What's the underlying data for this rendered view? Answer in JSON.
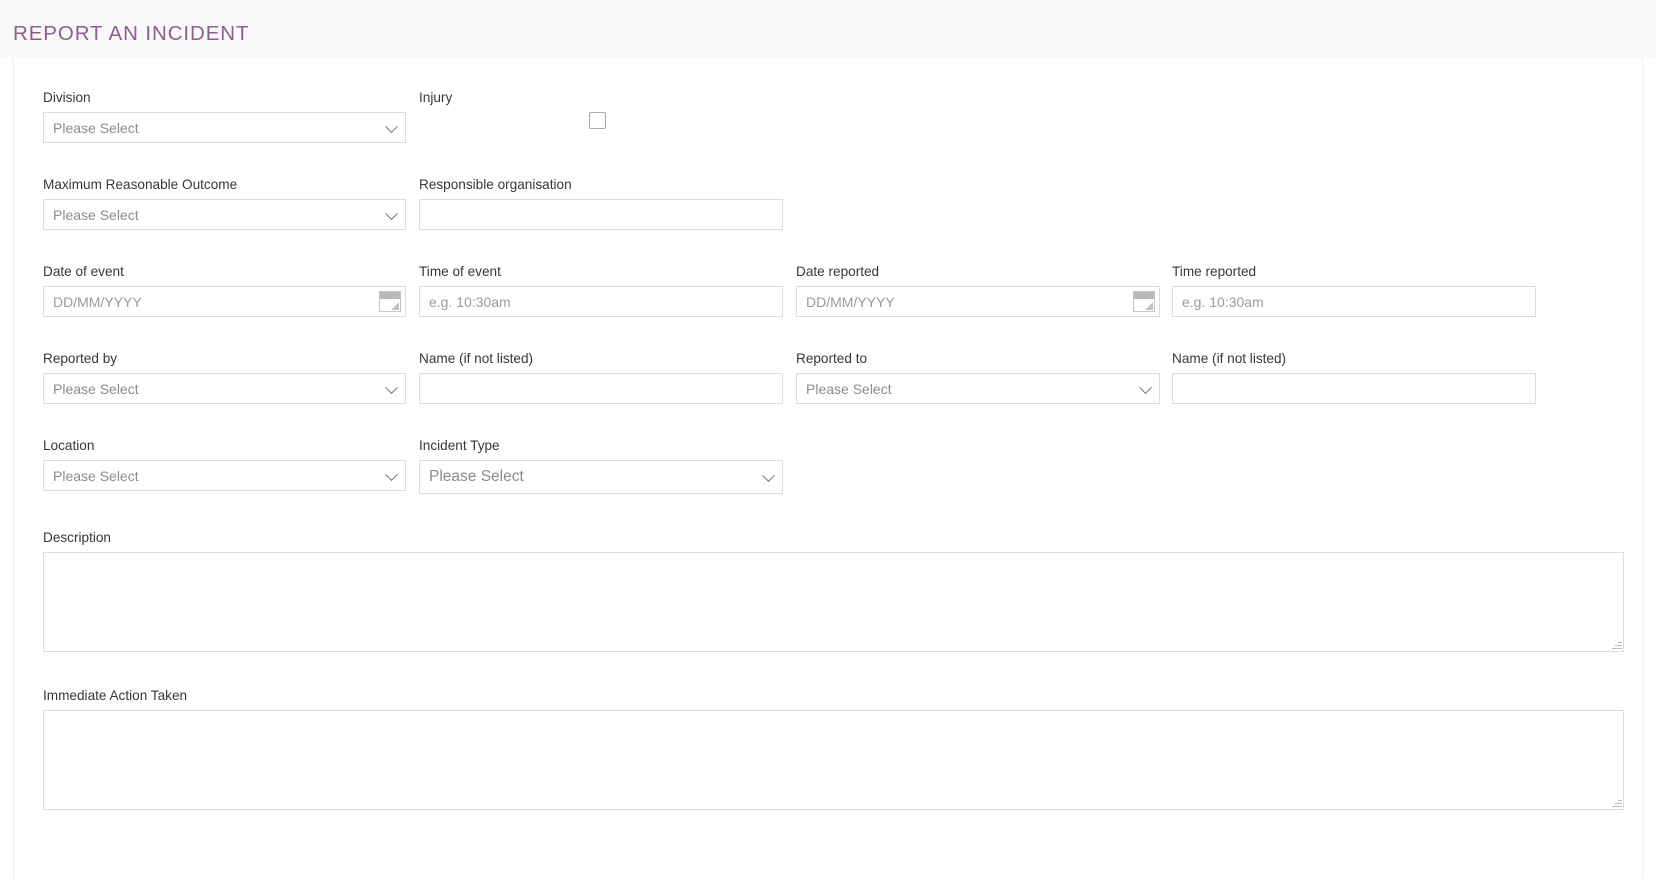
{
  "header": {
    "title": "REPORT AN INCIDENT",
    "title_color": "#8d5f8f",
    "band_color": "#f8f8f8"
  },
  "form": {
    "placeholder_select": "Please Select",
    "placeholder_date": "DD/MM/YYYY",
    "placeholder_time": "e.g. 10:30am",
    "fields": {
      "division": {
        "label": "Division",
        "value": "Please Select"
      },
      "injury": {
        "label": "Injury",
        "checked": false
      },
      "maximum_reasonable_outcome": {
        "label": "Maximum Reasonable Outcome",
        "value": "Please Select"
      },
      "responsible_organisation": {
        "label": "Responsible organisation",
        "value": "",
        "placeholder": ""
      },
      "date_of_event": {
        "label": "Date of event",
        "value": "",
        "placeholder": "DD/MM/YYYY"
      },
      "time_of_event": {
        "label": "Time of event",
        "value": "",
        "placeholder": "e.g. 10:30am"
      },
      "date_reported": {
        "label": "Date reported",
        "value": "",
        "placeholder": "DD/MM/YYYY"
      },
      "time_reported": {
        "label": "Time reported",
        "value": "",
        "placeholder": "e.g. 10:30am"
      },
      "reported_by": {
        "label": "Reported by",
        "value": "Please Select"
      },
      "reported_by_name": {
        "label": "Name (if not listed)",
        "value": "",
        "placeholder": ""
      },
      "reported_to": {
        "label": "Reported to",
        "value": "Please Select"
      },
      "reported_to_name": {
        "label": "Name (if not listed)",
        "value": "",
        "placeholder": ""
      },
      "location": {
        "label": "Location",
        "value": "Please Select"
      },
      "incident_type": {
        "label": "Incident Type",
        "value": "Please Select"
      },
      "description": {
        "label": "Description",
        "value": "",
        "placeholder": ""
      },
      "immediate_action_taken": {
        "label": "Immediate Action Taken",
        "value": "",
        "placeholder": ""
      }
    }
  },
  "icons": {
    "datepicker": "calendar-icon",
    "dropdown": "chevron-down-icon",
    "resize": "resize-grip-icon"
  }
}
